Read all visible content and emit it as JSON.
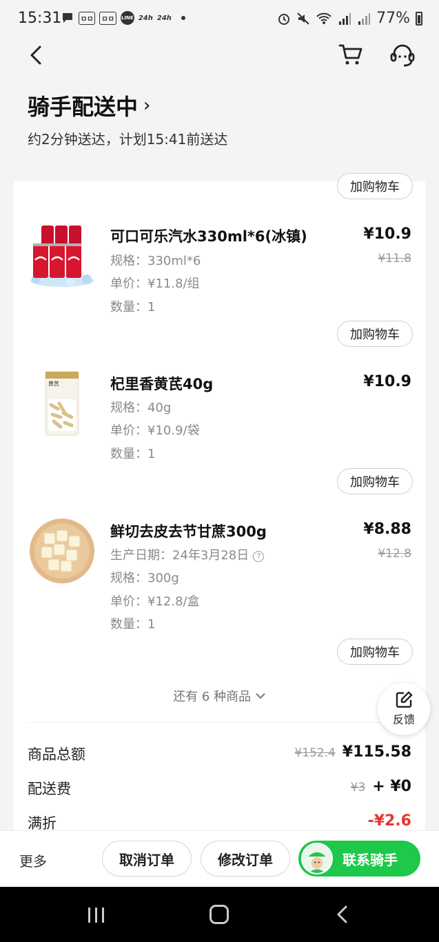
{
  "status_bar": {
    "time": "15:31",
    "chips": [
      "ㅁㅁ",
      "ㅁㅁ"
    ],
    "line_label": "LINE",
    "badges": [
      "24h",
      "24h"
    ],
    "battery": "77%"
  },
  "header": {
    "title": "骑手配送中",
    "title_chevron": "›",
    "subtitle": "约2分钟送达，计划15:41前送达"
  },
  "order": {
    "add_to_cart_label": "加购物车",
    "items": [
      {
        "name": "可口可乐汽水330ml*6(冰镇)",
        "spec": "规格：330ml*6",
        "unit_price": "单价：¥11.8/组",
        "quantity": "数量：1",
        "price": "¥10.9",
        "original_price": "¥11.8"
      },
      {
        "name": "杞里香黄芪40g",
        "spec": "规格：40g",
        "unit_price": "单价：¥10.9/袋",
        "quantity": "数量：1",
        "price": "¥10.9",
        "pack_text": "黄芪"
      },
      {
        "name": "鲜切去皮去节甘蔗300g",
        "production_date": "生产日期：24年3月28日",
        "spec": "规格：300g",
        "unit_price": "单价：¥12.8/盒",
        "quantity": "数量：1",
        "price": "¥8.88",
        "original_price": "¥12.8"
      }
    ],
    "more_items": "还有 6 种商品",
    "summary": {
      "goods_total_label": "商品总额",
      "goods_total_original": "¥152.4",
      "goods_total": "¥115.58",
      "delivery_fee_label": "配送费",
      "delivery_fee_original": "¥3",
      "delivery_fee": "+ ¥0",
      "discount_label": "满折",
      "discount": "-¥2.6"
    }
  },
  "feedback": {
    "label": "反馈"
  },
  "bottom_bar": {
    "more": "更多",
    "cancel": "取消订单",
    "modify": "修改订单",
    "contact": "联系骑手"
  },
  "colors": {
    "accent_green": "#1ec84a",
    "discount_red": "#e8342c",
    "background": "#f4f4f4"
  }
}
